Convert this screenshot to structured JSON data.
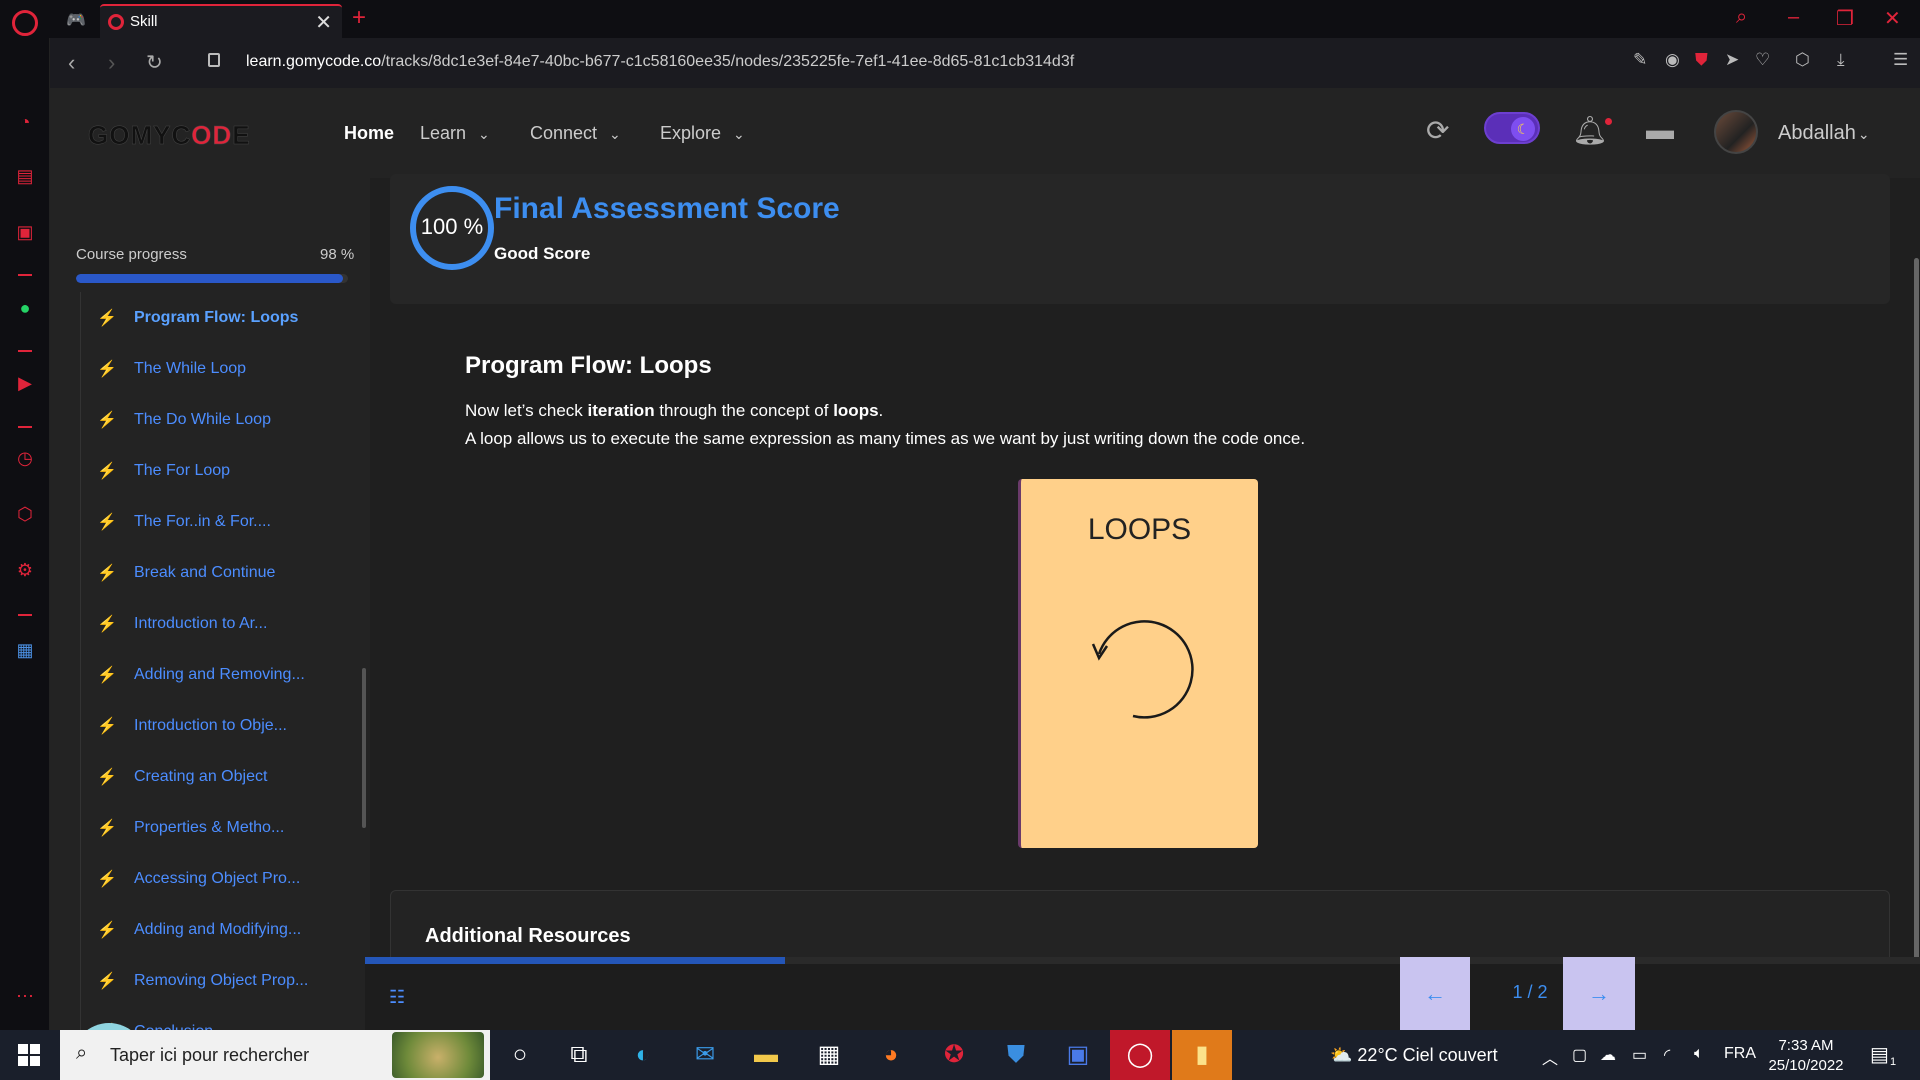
{
  "browser": {
    "tab_title": "Skill",
    "url_host": "learn.gomycode.co",
    "url_path": "/tracks/8dc1e3ef-84e7-40bc-b677-c1c58160ee35/nodes/235225fe-7ef1-41ee-8d65-81c1cb314d3f"
  },
  "header": {
    "logo_prefix": "GOMYC",
    "logo_mid": "OD",
    "logo_suffix": "E",
    "nav": [
      {
        "label": "Home"
      },
      {
        "label": "Learn"
      },
      {
        "label": "Connect"
      },
      {
        "label": "Explore"
      }
    ],
    "username": "Abdallah"
  },
  "course": {
    "progress_label": "Course progress",
    "progress_text": "98 %",
    "progress_value": 0.98,
    "lessons": [
      "Program Flow: Loops",
      "The While Loop",
      "The Do While Loop",
      "The For Loop",
      "The For..in & For....",
      "Break and Continue",
      "Introduction to Ar...",
      "Adding and Removing...",
      "Introduction to Obje...",
      "Creating an Object",
      "Properties & Metho...",
      "Accessing Object Pro...",
      "Adding and Modifying...",
      "Removing Object Prop...",
      "Conclusion"
    ]
  },
  "score": {
    "value": "100 %",
    "title": "Final Assessment Score",
    "subtitle": "Good Score"
  },
  "content": {
    "title": "Program Flow: Loops",
    "p1_a": "Now let’s check ",
    "p1_b": "iteration",
    "p1_c": " through the concept of ",
    "p1_d": "loops",
    "p1_e": ".",
    "p2": "A loop allows us to execute the same expression as many times as we want by just writing down the code once.",
    "card_label": "LOOPS",
    "resources_title": "Additional Resources"
  },
  "pager": {
    "indicator": "1 / 2",
    "content_progress": 0.27,
    "prev_icon": "←",
    "next_icon": "→"
  },
  "taskbar": {
    "search_placeholder": "Taper ici pour rechercher",
    "weather": "22°C  Ciel couvert",
    "lang": "FRA",
    "time": "7:33 AM",
    "date": "25/10/2022",
    "notif_count": "1"
  }
}
